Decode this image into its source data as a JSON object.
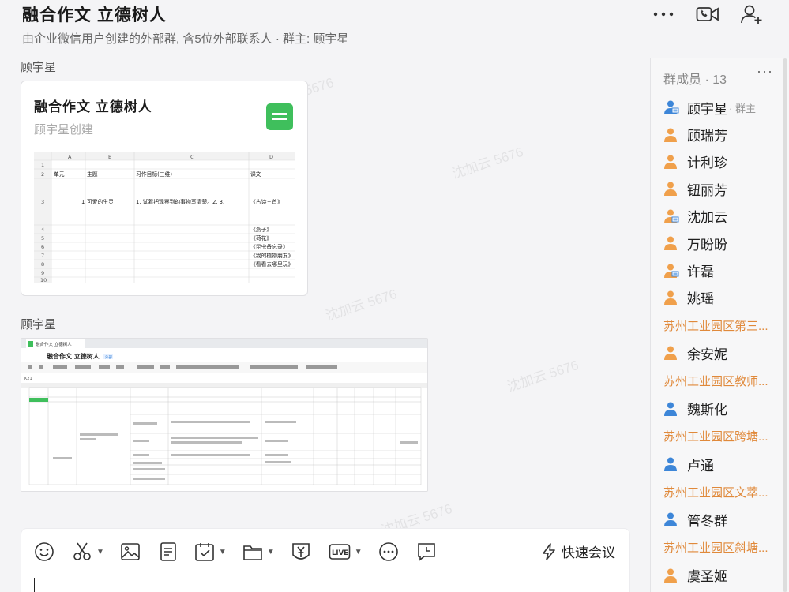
{
  "header": {
    "title": "融合作文 立德树人",
    "subtitle": "由企业微信用户创建的外部群, 含5位外部联系人 · 群主: 顾宇星",
    "icons": [
      "more-icon",
      "video-call-icon",
      "add-member-icon"
    ]
  },
  "chat": {
    "messages": [
      {
        "sender": "顾宇星",
        "doc_title": "融合作文 立德树人",
        "doc_creator": "顾宇星创建",
        "preview": {
          "col_letters": [
            "A",
            "B",
            "C",
            "D"
          ],
          "row_numbers": [
            "1",
            "2",
            "3",
            "4",
            "5",
            "6",
            "7",
            "8",
            "9",
            "10"
          ],
          "headers": [
            "单元",
            "主题",
            "习作目标(三维)",
            "课文"
          ],
          "row3": [
            "1",
            "可爱的生灵",
            "1. 试着把观察到的事物写清楚。2. 3.",
            "《古诗三首》"
          ],
          "lessons": [
            "《燕子》",
            "《荷花》",
            "《昆虫备忘录》",
            "《我的植物朋友》",
            "《看看去哪里玩》"
          ]
        }
      },
      {
        "sender": "顾宇星",
        "shot": {
          "tab_label": "融合作文 立德树人",
          "doc_title": "融合作文 立德树人",
          "tag": "外部",
          "cell_ref": "K21"
        }
      }
    ]
  },
  "watermark": "沈加云 5676",
  "composer": {
    "tools": [
      "emoji-icon",
      "screenshot-icon",
      "image-icon",
      "document-icon",
      "schedule-icon",
      "folder-icon",
      "red-packet-icon",
      "live-icon",
      "more-circle-icon",
      "history-icon"
    ],
    "quick_meeting": "快速会议"
  },
  "members": {
    "title": "群成员 · 13",
    "owner_tag": "· 群主",
    "items": [
      {
        "type": "member",
        "name": "顾宇星",
        "owner": true,
        "avatar": "blue-pc"
      },
      {
        "type": "member",
        "name": "顾瑞芳",
        "avatar": "orange"
      },
      {
        "type": "member",
        "name": "计利珍",
        "avatar": "orange"
      },
      {
        "type": "member",
        "name": "钮丽芳",
        "avatar": "orange"
      },
      {
        "type": "member",
        "name": "沈加云",
        "avatar": "orange-pc"
      },
      {
        "type": "member",
        "name": "万盼盼",
        "avatar": "orange"
      },
      {
        "type": "member",
        "name": "许磊",
        "avatar": "orange-pc"
      },
      {
        "type": "member",
        "name": "姚瑶",
        "avatar": "orange"
      },
      {
        "type": "group",
        "name": "苏州工业园区第三..."
      },
      {
        "type": "member",
        "name": "余安妮",
        "avatar": "orange"
      },
      {
        "type": "group",
        "name": "苏州工业园区教师..."
      },
      {
        "type": "member",
        "name": "魏斯化",
        "avatar": "blue"
      },
      {
        "type": "group",
        "name": "苏州工业园区跨塘..."
      },
      {
        "type": "member",
        "name": "卢通",
        "avatar": "blue"
      },
      {
        "type": "group",
        "name": "苏州工业园区文萃..."
      },
      {
        "type": "member",
        "name": "管冬群",
        "avatar": "blue"
      },
      {
        "type": "group",
        "name": "苏州工业园区斜塘..."
      },
      {
        "type": "member",
        "name": "虞圣姬",
        "avatar": "orange"
      }
    ]
  },
  "colors": {
    "orange_avatar": "#f0a04b",
    "blue_avatar": "#3d86d8",
    "group_label": "#e0893a",
    "sheet_green": "#3fbf5c"
  }
}
